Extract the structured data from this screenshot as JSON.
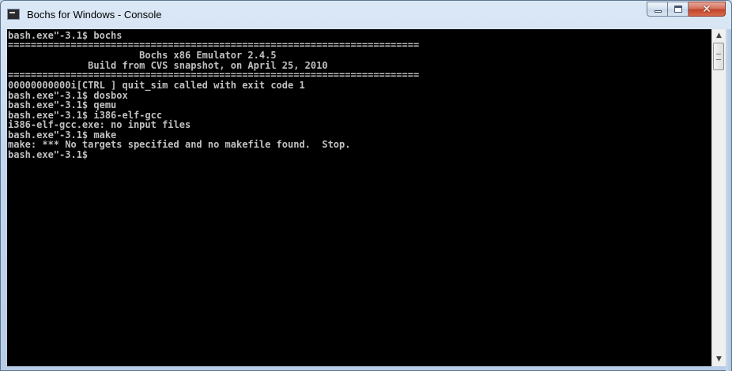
{
  "window": {
    "title": "Bochs for Windows - Console",
    "icon": "console-app-icon",
    "buttons": {
      "minimize": "minimize-icon",
      "maximize": "maximize-icon",
      "close": "close-icon"
    }
  },
  "console": {
    "background": "#000000",
    "foreground": "#c0c0c0",
    "lines": [
      "bash.exe\"-3.1$ bochs",
      "========================================================================",
      "                       Bochs x86 Emulator 2.4.5",
      "              Build from CVS snapshot, on April 25, 2010",
      "========================================================================",
      "00000000000i[CTRL ] quit_sim called with exit code 1",
      "bash.exe\"-3.1$ dosbox",
      "bash.exe\"-3.1$ qemu",
      "bash.exe\"-3.1$ i386-elf-gcc",
      "i386-elf-gcc.exe: no input files",
      "bash.exe\"-3.1$ make",
      "make: *** No targets specified and no makefile found.  Stop.",
      "bash.exe\"-3.1$"
    ]
  },
  "scrollbar": {
    "up": "▲",
    "down": "▼"
  }
}
